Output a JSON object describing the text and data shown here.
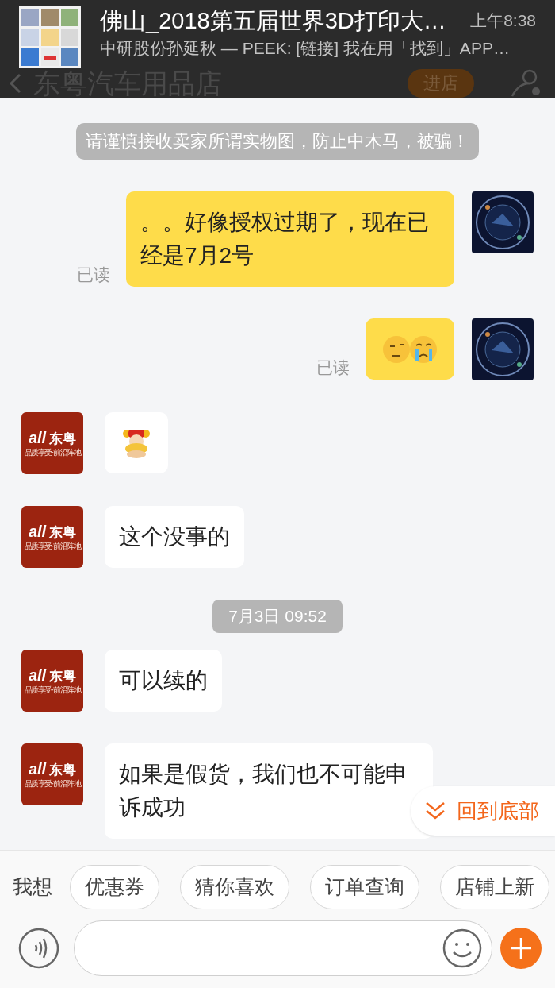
{
  "notification": {
    "title": "佛山_2018第五届世界3D打印大…",
    "time": "上午8:38",
    "text": "中研股份孙延秋 — PEEK: [链接] 我在用「找到」APP…"
  },
  "header": {
    "title": "东粤汽车用品店",
    "button": "进店"
  },
  "messages": [
    {
      "kind": "notice",
      "text": "请谨慎接收卖家所谓实物图，防止中木马，被骗！"
    },
    {
      "kind": "sent_text",
      "text": "。。好像授权过期了，现在已经是7月2号",
      "status": "已读"
    },
    {
      "kind": "sent_emoji",
      "status": "已读"
    },
    {
      "kind": "received_sticker",
      "logo": {
        "mark": "all",
        "name": "东粤",
        "slogan": "品质享受·前沿阵地"
      }
    },
    {
      "kind": "received_text",
      "text": "这个没事的",
      "logo": {
        "mark": "all",
        "name": "东粤",
        "slogan": "品质享受·前沿阵地"
      }
    },
    {
      "kind": "time",
      "text": "7月3日 09:52"
    },
    {
      "kind": "received_text",
      "text": "可以续的",
      "logo": {
        "mark": "all",
        "name": "东粤",
        "slogan": "品质享受·前沿阵地"
      }
    },
    {
      "kind": "received_text",
      "text": "如果是假货，我们也不可能申诉成功",
      "logo": {
        "mark": "all",
        "name": "东粤",
        "slogan": "品质享受·前沿阵地"
      }
    }
  ],
  "jump_button": "回到底部",
  "quick_replies": {
    "label": "我想",
    "chips": [
      "优惠券",
      "猜你喜欢",
      "订单查询",
      "店铺上新"
    ]
  }
}
